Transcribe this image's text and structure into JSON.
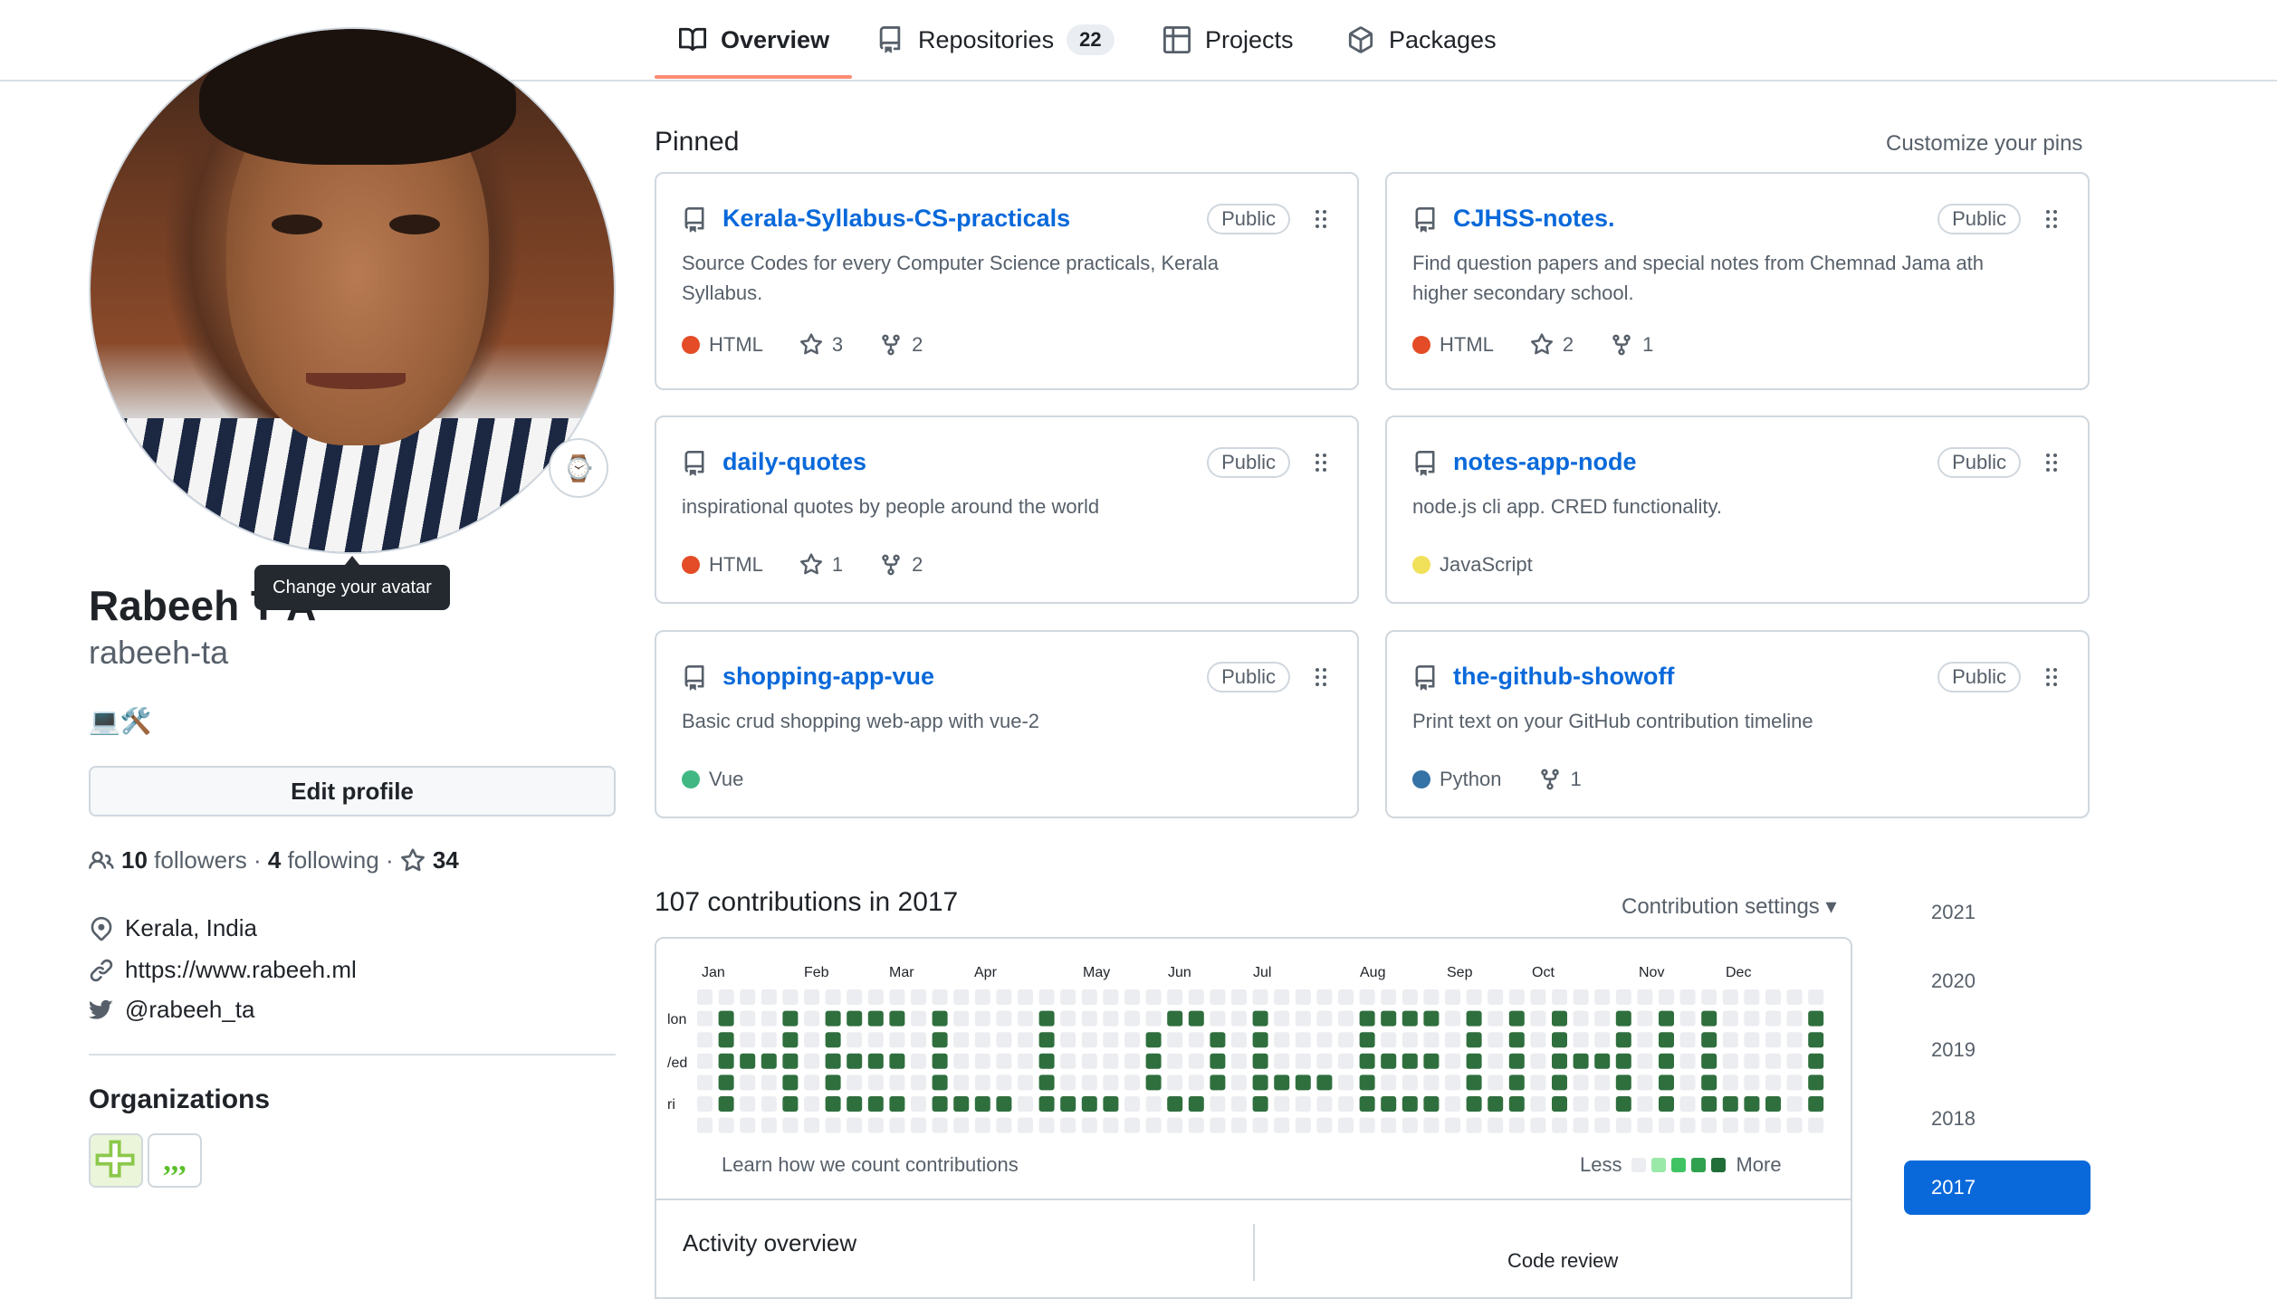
{
  "nav": {
    "tabs": [
      {
        "label": "Overview",
        "icon": "book-icon",
        "active": true
      },
      {
        "label": "Repositories",
        "icon": "repo-icon",
        "count": "22"
      },
      {
        "label": "Projects",
        "icon": "table-icon"
      },
      {
        "label": "Packages",
        "icon": "package-icon"
      }
    ]
  },
  "profile": {
    "tooltip": "Change your avatar",
    "status_emoji": "⌚",
    "name": "Rabeeh T A",
    "login": "rabeeh-ta",
    "bio": "💻🛠️",
    "edit_label": "Edit profile",
    "followers_count": "10",
    "followers_label": "followers",
    "following_count": "4",
    "following_label": "following",
    "stars_count": "34",
    "location": "Kerala, India",
    "website": "https://www.rabeeh.ml",
    "twitter": "@rabeeh_ta",
    "organizations_title": "Organizations"
  },
  "pinned": {
    "title": "Pinned",
    "customize_label": "Customize your pins",
    "repos": [
      {
        "name": "Kerala-Syllabus-CS-practicals",
        "visibility": "Public",
        "description": "Source Codes for every Computer Science practicals, Kerala Syllabus.",
        "language": "HTML",
        "lang_color": "#e34c26",
        "stars": "3",
        "forks": "2"
      },
      {
        "name": "CJHSS-notes.",
        "visibility": "Public",
        "description": "Find question papers and special notes from Chemnad Jama ath higher secondary school.",
        "language": "HTML",
        "lang_color": "#e34c26",
        "stars": "2",
        "forks": "1"
      },
      {
        "name": "daily-quotes",
        "visibility": "Public",
        "description": "inspirational quotes by people around the world",
        "language": "HTML",
        "lang_color": "#e34c26",
        "stars": "1",
        "forks": "2"
      },
      {
        "name": "notes-app-node",
        "visibility": "Public",
        "description": "node.js cli app. CRED functionality.",
        "language": "JavaScript",
        "lang_color": "#f1e05a"
      },
      {
        "name": "shopping-app-vue",
        "visibility": "Public",
        "description": "Basic crud shopping web-app with vue-2",
        "language": "Vue",
        "lang_color": "#41b883"
      },
      {
        "name": "the-github-showoff",
        "visibility": "Public",
        "description": "Print text on your GitHub contribution timeline",
        "language": "Python",
        "lang_color": "#3572a5",
        "forks": "1"
      }
    ]
  },
  "contributions": {
    "title": "107 contributions in 2017",
    "settings_label": "Contribution settings ▾",
    "months": [
      "Jan",
      "Feb",
      "Mar",
      "Apr",
      "May",
      "Jun",
      "Jul",
      "Aug",
      "Sep",
      "Oct",
      "Nov",
      "Dec"
    ],
    "days": [
      "lon",
      "/ed",
      "ri"
    ],
    "learn_label": "Learn how we count contributions",
    "legend_less": "Less",
    "legend_more": "More",
    "legend_colors": [
      "#ebedf0",
      "#9be9a8",
      "#40c463",
      "#30a14e",
      "#216e39"
    ],
    "cell_empty_color": "#ebedf0",
    "cell_active_color": "#2f6f3e",
    "activity_title": "Activity overview",
    "code_review_label": "Code review"
  },
  "years": [
    "2021",
    "2020",
    "2019",
    "2018",
    "2017"
  ],
  "selected_year": "2017"
}
